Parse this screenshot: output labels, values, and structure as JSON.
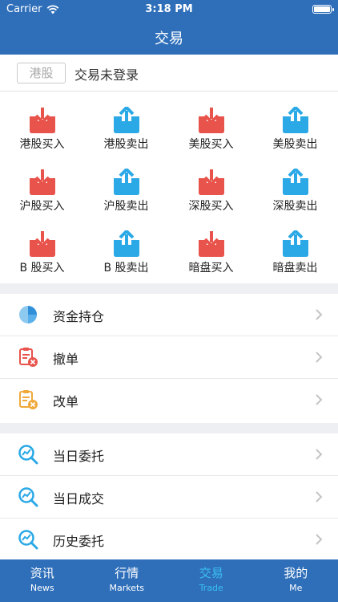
{
  "status_bar": {
    "carrier": "Carrier",
    "time": "3:18 PM"
  },
  "nav": {
    "title": "交易"
  },
  "login": {
    "market_tag": "港股",
    "status": "交易未登录"
  },
  "colors": {
    "accent": "#2f6fba",
    "buy": "#e8534b",
    "sell": "#2aa9e6",
    "active_tab": "#39c0f0"
  },
  "trade_grid": [
    {
      "label": "港股买入",
      "type": "buy",
      "icon": "tray-download-icon"
    },
    {
      "label": "港股卖出",
      "type": "sell",
      "icon": "tray-upload-icon"
    },
    {
      "label": "美股买入",
      "type": "buy",
      "icon": "tray-download-icon"
    },
    {
      "label": "美股卖出",
      "type": "sell",
      "icon": "tray-upload-icon"
    },
    {
      "label": "沪股买入",
      "type": "buy",
      "icon": "tray-download-icon"
    },
    {
      "label": "沪股卖出",
      "type": "sell",
      "icon": "tray-upload-icon"
    },
    {
      "label": "深股买入",
      "type": "buy",
      "icon": "tray-download-icon"
    },
    {
      "label": "深股卖出",
      "type": "sell",
      "icon": "tray-upload-icon"
    },
    {
      "label": "B 股买入",
      "type": "buy",
      "icon": "tray-download-icon"
    },
    {
      "label": "B 股卖出",
      "type": "sell",
      "icon": "tray-upload-icon"
    },
    {
      "label": "暗盘买入",
      "type": "buy",
      "icon": "tray-download-icon"
    },
    {
      "label": "暗盘卖出",
      "type": "sell",
      "icon": "tray-upload-icon"
    }
  ],
  "menu_group_1": [
    {
      "label": "资金持仓",
      "icon": "pie-chart-icon"
    },
    {
      "label": "撤单",
      "icon": "clipboard-cancel-icon"
    },
    {
      "label": "改单",
      "icon": "clipboard-edit-icon"
    }
  ],
  "menu_group_2": [
    {
      "label": "当日委托",
      "icon": "magnifier-chart-icon"
    },
    {
      "label": "当日成交",
      "icon": "magnifier-chart-icon"
    },
    {
      "label": "历史委托",
      "icon": "magnifier-chart-icon"
    }
  ],
  "tabs": [
    {
      "cn": "资讯",
      "en": "News",
      "active": false
    },
    {
      "cn": "行情",
      "en": "Markets",
      "active": false
    },
    {
      "cn": "交易",
      "en": "Trade",
      "active": true
    },
    {
      "cn": "我的",
      "en": "Me",
      "active": false
    }
  ]
}
